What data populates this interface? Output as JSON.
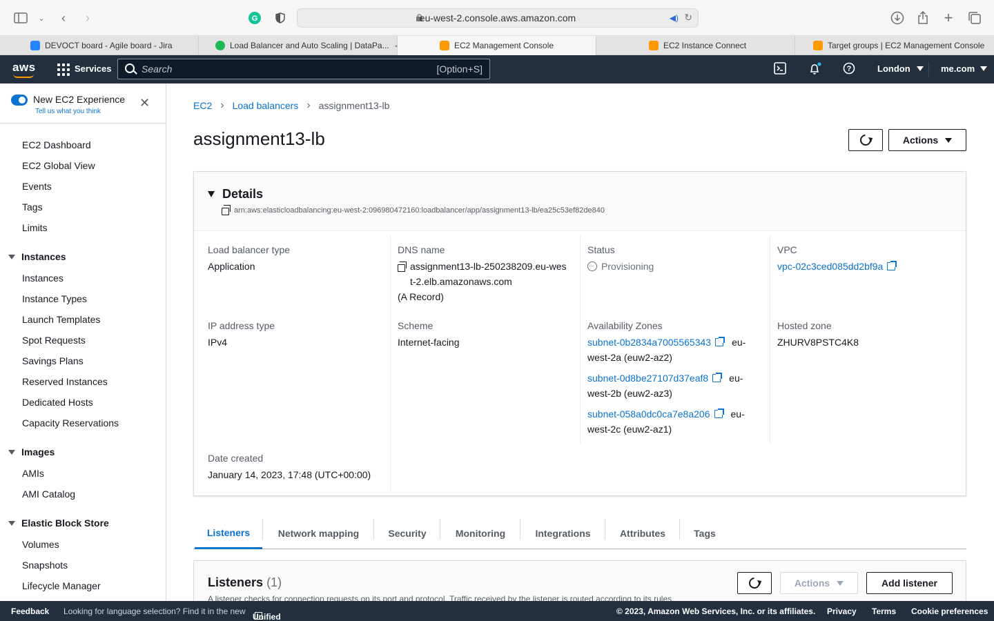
{
  "browser": {
    "url": "eu-west-2.console.aws.amazon.com",
    "tabs": [
      {
        "label": "DEVOCT board - Agile board - Jira",
        "favicon_color": "#2684ff"
      },
      {
        "label": "Load Balancer and Auto Scaling | DataPa...",
        "favicon_color": "#1db954"
      },
      {
        "label": "EC2 Management Console",
        "favicon_color": "#ff9900"
      },
      {
        "label": "EC2 Instance Connect",
        "favicon_color": "#ff9900"
      },
      {
        "label": "Target groups | EC2 Management Console",
        "favicon_color": "#ff9900"
      }
    ]
  },
  "aws_nav": {
    "logo": "aws",
    "services": "Services",
    "search_placeholder": "Search",
    "search_shortcut": "[Option+S]",
    "region": "London",
    "account": "me.com"
  },
  "sidebar": {
    "new_experience_title": "New EC2 Experience",
    "new_experience_link": "Tell us what you think",
    "top_items": [
      "EC2 Dashboard",
      "EC2 Global View",
      "Events",
      "Tags",
      "Limits"
    ],
    "sections": [
      {
        "title": "Instances",
        "items": [
          "Instances",
          "Instance Types",
          "Launch Templates",
          "Spot Requests",
          "Savings Plans",
          "Reserved Instances",
          "Dedicated Hosts",
          "Capacity Reservations"
        ]
      },
      {
        "title": "Images",
        "items": [
          "AMIs",
          "AMI Catalog"
        ]
      },
      {
        "title": "Elastic Block Store",
        "items": [
          "Volumes",
          "Snapshots",
          "Lifecycle Manager"
        ]
      }
    ]
  },
  "breadcrumb": [
    "EC2",
    "Load balancers",
    "assignment13-lb"
  ],
  "page": {
    "title": "assignment13-lb",
    "actions_label": "Actions"
  },
  "details": {
    "title": "Details",
    "arn": "arn:aws:elasticloadbalancing:eu-west-2:096980472160:loadbalancer/app/assignment13-lb/ea25c53ef82de840",
    "lb_type_label": "Load balancer type",
    "lb_type": "Application",
    "dns_label": "DNS name",
    "dns_line1": "assignment13-lb-250238209.eu-wes",
    "dns_line2": "t-2.elb.amazonaws.com",
    "dns_record": "(A Record)",
    "status_label": "Status",
    "status": "Provisioning",
    "vpc_label": "VPC",
    "vpc": "vpc-02c3ced085dd2bf9a",
    "ip_type_label": "IP address type",
    "ip_type": "IPv4",
    "scheme_label": "Scheme",
    "scheme": "Internet-facing",
    "az_label": "Availability Zones",
    "azs": [
      {
        "subnet": "subnet-0b2834a7005565343",
        "zone_a": "eu-",
        "zone_b": "west-2a (euw2-az2)"
      },
      {
        "subnet": "subnet-0d8be27107d37eaf8",
        "zone_a": "eu-",
        "zone_b": "west-2b (euw2-az3)"
      },
      {
        "subnet": "subnet-058a0dc0ca7e8a206",
        "zone_a": "eu-",
        "zone_b": "west-2c (euw2-az1)"
      }
    ],
    "hosted_zone_label": "Hosted zone",
    "hosted_zone": "ZHURV8PSTC4K8",
    "date_label": "Date created",
    "date": "January 14, 2023, 17:48 (UTC+00:00)"
  },
  "content_tabs": [
    "Listeners",
    "Network mapping",
    "Security",
    "Monitoring",
    "Integrations",
    "Attributes",
    "Tags"
  ],
  "listeners": {
    "title": "Listeners",
    "count": "(1)",
    "actions_label": "Actions",
    "add_label": "Add listener",
    "description": "A listener checks for connection requests on its port and protocol. Traffic received by the listener is routed according to its rules."
  },
  "footer": {
    "feedback": "Feedback",
    "lang_text": "Looking for language selection? Find it in the new",
    "unified_settings": "Unified Settings",
    "copyright": "© 2023, Amazon Web Services, Inc. or its affiliates.",
    "privacy": "Privacy",
    "terms": "Terms",
    "cookies": "Cookie preferences"
  },
  "colors": {
    "aws_nav": "#232f3e",
    "link": "#0972d3",
    "aws_orange": "#ff9900"
  }
}
